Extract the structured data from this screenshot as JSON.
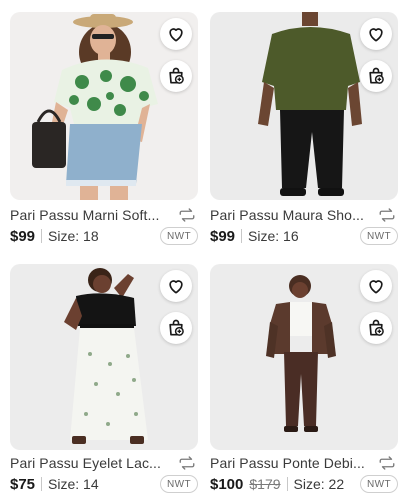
{
  "listings": [
    {
      "title": "Pari Passu Marni Soft...",
      "price": "$99",
      "original_price": "",
      "size": "Size: 18",
      "condition_badge": "NWT",
      "image_alt": "Woman in green floral top and denim skirt"
    },
    {
      "title": "Pari Passu Maura Sho...",
      "price": "$99",
      "original_price": "",
      "size": "Size: 16",
      "condition_badge": "NWT",
      "image_alt": "Woman in olive green tee and black cropped pants"
    },
    {
      "title": "Pari Passu Eyelet Lac...",
      "price": "$75",
      "original_price": "",
      "size": "Size: 14",
      "condition_badge": "NWT",
      "image_alt": "Woman in black top and white eyelet maxi skirt"
    },
    {
      "title": "Pari Passu Ponte Debi...",
      "price": "$100",
      "original_price": "$179",
      "size": "Size: 22",
      "condition_badge": "NWT",
      "image_alt": "Woman in brown blazer and brown trousers"
    }
  ],
  "icons": {
    "like": "heart-icon",
    "bundle": "bag-plus-icon",
    "share": "repost-icon"
  },
  "colors": {
    "text_primary": "#1a1a1a",
    "text_secondary": "#3a3a3a",
    "badge_border": "#cfcfcf",
    "strike_price": "#7a7a7a"
  }
}
